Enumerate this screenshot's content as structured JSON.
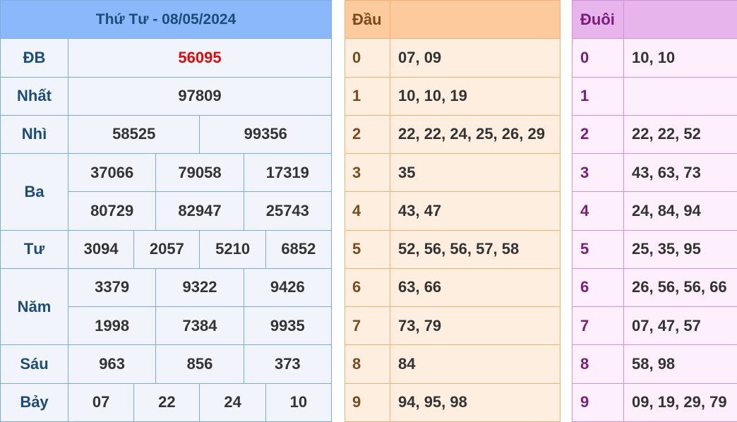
{
  "results": {
    "date_title": "Thứ Tư - 08/05/2024",
    "rows": {
      "db": {
        "label": "ĐB",
        "values": [
          "56095"
        ]
      },
      "nhat": {
        "label": "Nhất",
        "values": [
          "97809"
        ]
      },
      "nhi": {
        "label": "Nhì",
        "values": [
          "58525",
          "99356"
        ]
      },
      "ba": {
        "label": "Ba",
        "values": [
          "37066",
          "79058",
          "17319",
          "80729",
          "82947",
          "25743"
        ]
      },
      "tu": {
        "label": "Tư",
        "values": [
          "3094",
          "2057",
          "5210",
          "6852"
        ]
      },
      "nam": {
        "label": "Năm",
        "values": [
          "3379",
          "9322",
          "9426",
          "1998",
          "7384",
          "9935"
        ]
      },
      "sau": {
        "label": "Sáu",
        "values": [
          "963",
          "856",
          "373"
        ]
      },
      "bay": {
        "label": "Bảy",
        "values": [
          "07",
          "22",
          "24",
          "10"
        ]
      }
    },
    "colors": {
      "special_prize": "#e5080b",
      "header_bg": "#8ab8fb",
      "label": "#1c4c78"
    }
  },
  "head_table": {
    "title": "Đầu",
    "rows": [
      {
        "digit": "0",
        "values": "07, 09"
      },
      {
        "digit": "1",
        "values": "10, 10, 19"
      },
      {
        "digit": "2",
        "values": "22, 22, 24, 25, 26, 29"
      },
      {
        "digit": "3",
        "values": "35"
      },
      {
        "digit": "4",
        "values": "43, 47"
      },
      {
        "digit": "5",
        "values": "52, 56, 56, 57, 58"
      },
      {
        "digit": "6",
        "values": "63, 66"
      },
      {
        "digit": "7",
        "values": "73, 79"
      },
      {
        "digit": "8",
        "values": "84"
      },
      {
        "digit": "9",
        "values": "94, 95, 98"
      }
    ],
    "colors": {
      "header_bg": "#fcca9d",
      "body_bg": "#fdeee0",
      "digit": "#7b4a1c"
    }
  },
  "tail_table": {
    "title": "Đuôi",
    "rows": [
      {
        "digit": "0",
        "values": "10, 10"
      },
      {
        "digit": "1",
        "values": ""
      },
      {
        "digit": "2",
        "values": "22, 22, 52"
      },
      {
        "digit": "3",
        "values": "43, 63, 73"
      },
      {
        "digit": "4",
        "values": "24, 84, 94"
      },
      {
        "digit": "5",
        "values": "25, 35, 95"
      },
      {
        "digit": "6",
        "values": "26, 56, 56, 66"
      },
      {
        "digit": "7",
        "values": "07, 47, 57"
      },
      {
        "digit": "8",
        "values": "58, 98"
      },
      {
        "digit": "9",
        "values": "09, 19, 29, 79"
      }
    ],
    "colors": {
      "header_bg": "#e7b5eb",
      "body_bg": "#fdeffb",
      "digit": "#7a1c7c"
    }
  }
}
